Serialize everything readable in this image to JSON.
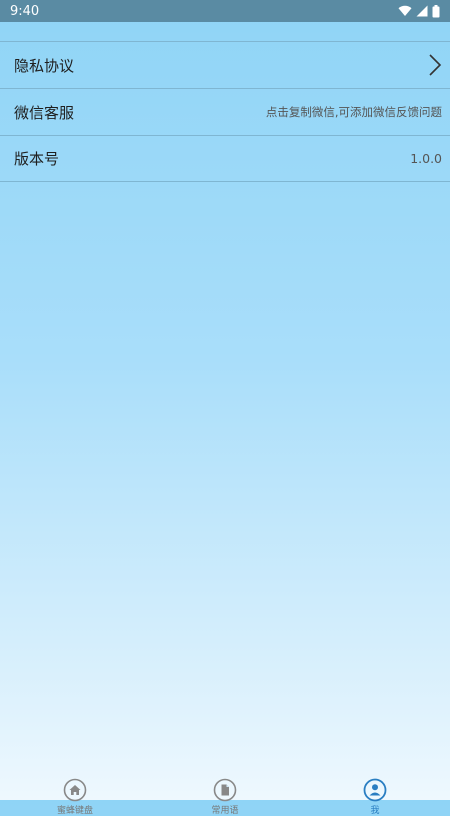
{
  "status_bar": {
    "time": "9:40"
  },
  "settings": {
    "items": [
      {
        "label": "隐私协议"
      },
      {
        "label": "微信客服",
        "value": "点击复制微信,可添加微信反馈问题"
      },
      {
        "label": "版本号",
        "value": "1.0.0"
      }
    ]
  },
  "tabs": [
    {
      "label": "蜜蜂键盘",
      "icon": "home-icon"
    },
    {
      "label": "常用语",
      "icon": "document-icon"
    },
    {
      "label": "我",
      "icon": "user-icon",
      "active": true
    }
  ],
  "colors": {
    "status_bar": "#5a8ba3",
    "active_tab": "#2a7ec2",
    "inactive_tab": "#888888",
    "divider": "#7fb6d2"
  }
}
